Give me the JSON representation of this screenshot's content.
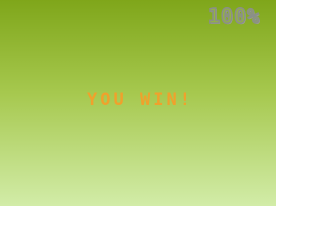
{
  "hud": {
    "score_text": "100%"
  },
  "overlay": {
    "message": "YOU WIN!"
  },
  "colors": {
    "background_top": "#7fa61a",
    "background_bottom": "#d2eca8",
    "message": "#f0a12c",
    "score": "#8b8f88"
  }
}
